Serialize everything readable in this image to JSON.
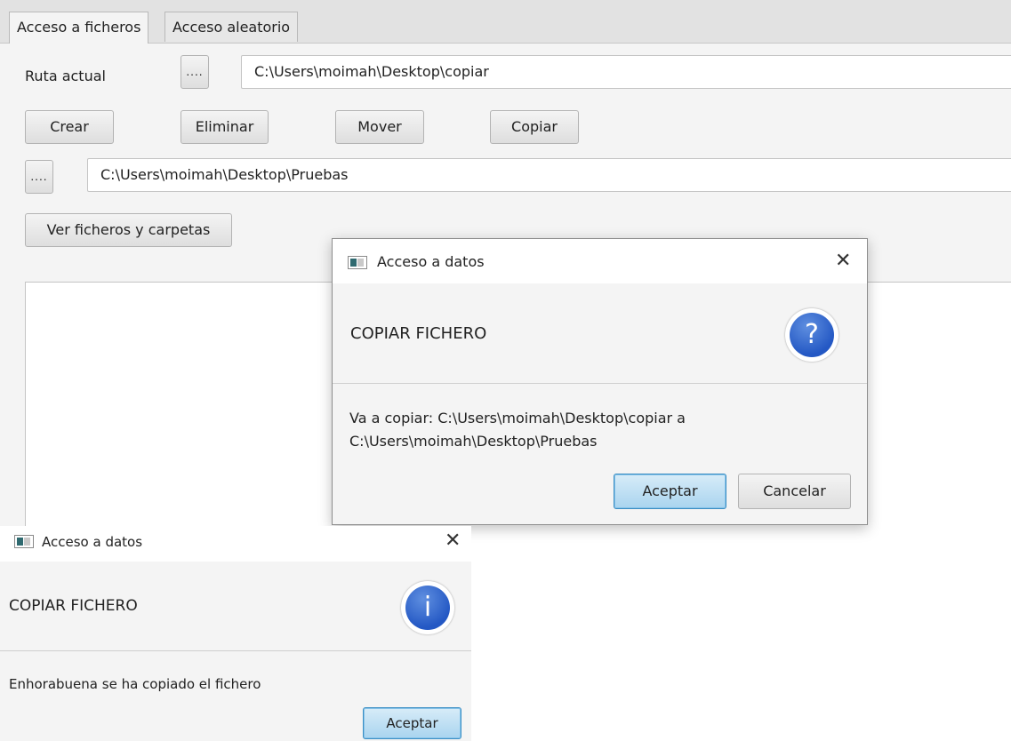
{
  "tabs": [
    {
      "label": "Acceso a ficheros",
      "active": true
    },
    {
      "label": "Acceso aleatorio",
      "active": false
    }
  ],
  "form": {
    "current_path_label": "Ruta actual",
    "browse_label": "....",
    "current_path_value": "C:\\Users\\moimah\\Desktop\\copiar",
    "dest_browse_label": "....",
    "dest_path_value": "C:\\Users\\moimah\\Desktop\\Pruebas",
    "view_files_label": "Ver ficheros y carpetas"
  },
  "actions": {
    "create": "Crear",
    "delete": "Eliminar",
    "move": "Mover",
    "copy": "Copiar"
  },
  "confirm_dialog": {
    "title": "Acceso a datos",
    "close": "✕",
    "header": "COPIAR FICHERO",
    "icon_glyph": "?",
    "icon": "question-icon",
    "message_line1": "Va a copiar: C:\\Users\\moimah\\Desktop\\copiar a",
    "message_line2": "C:\\Users\\moimah\\Desktop\\Pruebas",
    "ok": "Aceptar",
    "cancel": "Cancelar"
  },
  "info_dialog": {
    "title": "Acceso a datos",
    "close": "✕",
    "header": "COPIAR FICHERO",
    "icon_glyph": "i",
    "icon": "info-icon",
    "message": "Enhorabuena se ha copiado el fichero",
    "ok": "Aceptar"
  },
  "colors": {
    "accent": "#2458c4",
    "default_button": "#a9d4ef"
  }
}
